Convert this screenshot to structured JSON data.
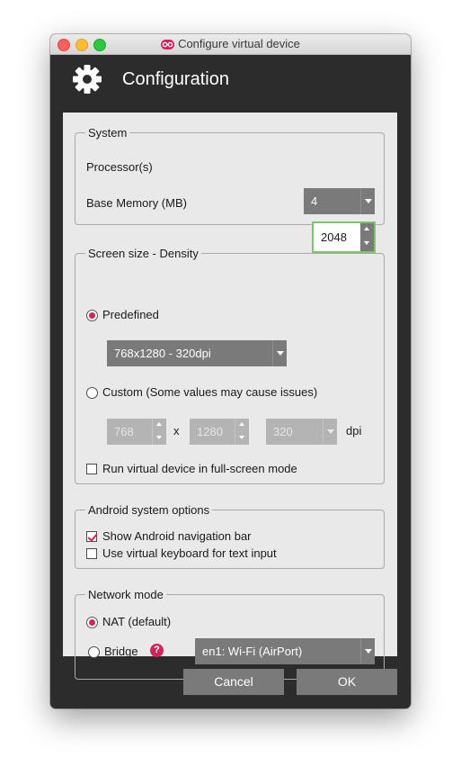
{
  "window": {
    "title": "Configure virtual device"
  },
  "header": {
    "title": "Configuration",
    "icon": "gear-icon"
  },
  "system": {
    "legend": "System",
    "processor_label": "Processor(s)",
    "processor_value": "4",
    "memory_label": "Base Memory (MB)",
    "memory_value": "2048"
  },
  "screen": {
    "legend": "Screen size - Density",
    "predefined_label": "Predefined",
    "predefined_value": "768x1280 - 320dpi",
    "custom_label": "Custom (Some values may cause issues)",
    "width_value": "768",
    "x_label": "x",
    "height_value": "1280",
    "dpi_value": "320",
    "dpi_label": "dpi",
    "fullscreen_label": "Run virtual device in full-screen mode"
  },
  "android": {
    "legend": "Android system options",
    "nav_bar_label": "Show Android navigation bar",
    "nav_bar_checked": true,
    "virtual_kbd_label": "Use virtual keyboard for text input",
    "virtual_kbd_checked": false
  },
  "network": {
    "legend": "Network mode",
    "nat_label": "NAT (default)",
    "bridge_label": "Bridge",
    "help_glyph": "?",
    "interface_value": "en1: Wi-Fi (AirPort)"
  },
  "footer": {
    "cancel_label": "Cancel",
    "ok_label": "OK"
  },
  "colors": {
    "accent": "#d6215a",
    "focus": "#7cc66a",
    "control": "#7a7a7a",
    "chrome": "#2c2c2c"
  }
}
